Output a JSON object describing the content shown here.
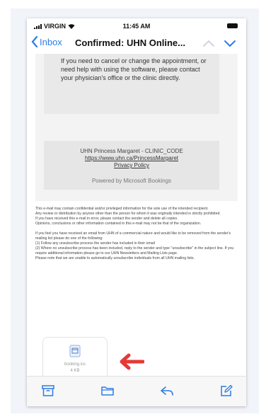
{
  "status_bar": {
    "carrier": "VIRGIN",
    "time": "11:45 AM"
  },
  "nav": {
    "back_label": "Inbox",
    "subject": "Confirmed: UHN Online..."
  },
  "email": {
    "cancel_text": "If you need to cancel or change the appointment, or need help with using the software, please contact your physician's office or the clinic directly.",
    "footer_org": "UHN Princess Margaret - CLINIC_CODE",
    "footer_link": "https://www.uhn.ca/PrincessMargaret",
    "privacy_link": "Privacy Policy",
    "powered_by": "Powered by Microsoft Bookings",
    "disclaimer": [
      "This e-mail may contain confidential and/or privileged information for the sole use of the intended recipient.",
      "Any review or distribution by anyone other than the person for whom it was originally intended is strictly prohibited.",
      "If you have received this e-mail in error, please contact the sender and delete all copies.",
      "Opinions, conclusions or other information contained in this e-mail may not be that of the organization."
    ],
    "unsubscribe": [
      "If you feel you have received an email from UHN of a commercial nature and would like to be removed from the sender's mailing list please do one of the following:",
      "(1) Follow any unsubscribe process the sender has included in their email",
      "(2) Where no unsubscribe process has been included, reply to the sender and type \"unsubscribe\" in the subject line. If you require additional information please go to our UHN Newsletters and Mailing Lists page.",
      "Please note that we are unable to automatically unsubscribe individuals from all UHN mailing lists."
    ]
  },
  "attachment": {
    "name": "booking.ics",
    "size": "4 KB",
    "icon": "calendar-file-icon"
  },
  "colors": {
    "accent": "#2c7be5",
    "arrow": "#e53935"
  },
  "toolbar": [
    "archive-icon",
    "folder-icon",
    "reply-icon",
    "compose-icon"
  ]
}
